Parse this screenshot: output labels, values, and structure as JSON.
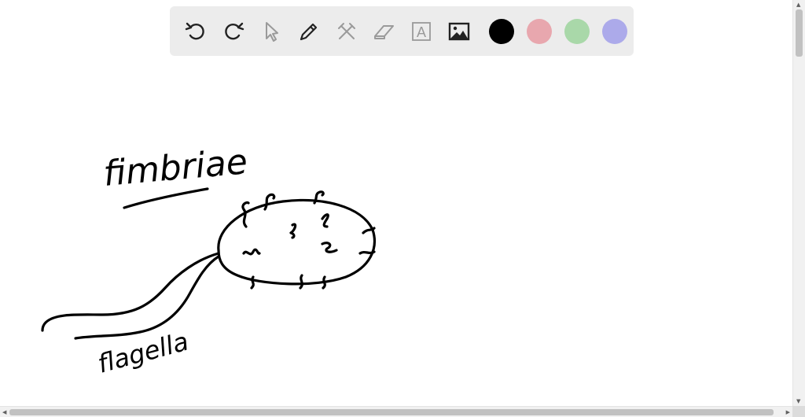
{
  "toolbar": {
    "tools": [
      {
        "name": "undo-icon",
        "label": "undo"
      },
      {
        "name": "redo-icon",
        "label": "redo"
      },
      {
        "name": "select-icon",
        "label": "select"
      },
      {
        "name": "pen-icon",
        "label": "pen"
      },
      {
        "name": "tools-icon",
        "label": "tools"
      },
      {
        "name": "eraser-icon",
        "label": "eraser"
      },
      {
        "name": "text-icon",
        "label": "text"
      },
      {
        "name": "image-icon",
        "label": "image"
      }
    ],
    "text_tool_glyph": "A",
    "colors": [
      {
        "name": "black",
        "hex": "#000000",
        "selected": true
      },
      {
        "name": "red",
        "hex": "#e8a7ae",
        "selected": false
      },
      {
        "name": "green",
        "hex": "#a9d8a9",
        "selected": false
      },
      {
        "name": "purple",
        "hex": "#acaaea",
        "selected": false
      }
    ]
  },
  "drawing": {
    "labels": {
      "fimbriae": "fimbriae",
      "flagella": "flagella"
    }
  }
}
